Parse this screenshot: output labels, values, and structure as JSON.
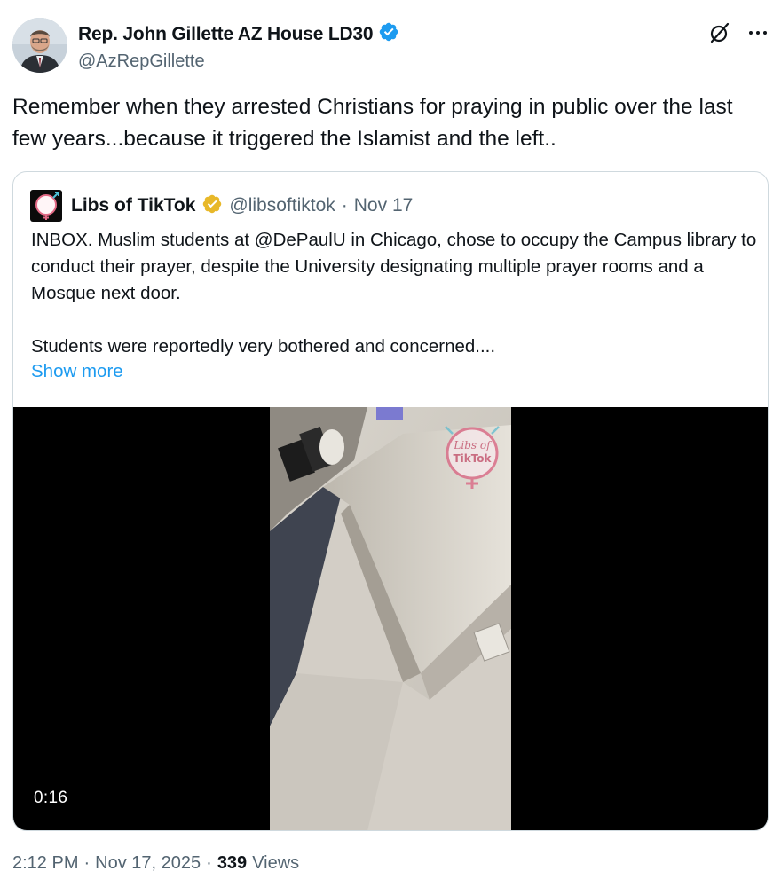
{
  "author": {
    "name": "Rep. John Gillette AZ House LD30",
    "handle": "@AzRepGillette",
    "verified_color": "#1d9bf0"
  },
  "header_icons": [
    "grok-icon",
    "more-icon"
  ],
  "tweet": {
    "text": "Remember when they arrested Christians for praying in public over the last few years...because it triggered the Islamist and the left.."
  },
  "quote": {
    "name": "Libs of TikTok",
    "handle": "@libsoftiktok",
    "separator": "·",
    "date": "Nov 17",
    "verified_color": "#e8b829",
    "avatar_text": "Libs of TikTok",
    "body": "INBOX. Muslim students at @DePaulU in Chicago, chose to occupy the Campus library to conduct their prayer, despite the University designating multiple prayer rooms and a Mosque next door.\n\nStudents were reportedly very bothered and concerned....",
    "show_more": "Show more",
    "video": {
      "duration": "0:16",
      "watermark": "Libs of TikTok"
    }
  },
  "meta": {
    "time": "2:12 PM",
    "separator1": "·",
    "date": "Nov 17, 2025",
    "separator2": "·",
    "views_count": "339",
    "views_label": "Views"
  },
  "colors": {
    "text_primary": "#0f1419",
    "text_secondary": "#536471",
    "link": "#1d9bf0",
    "border": "#cfd9de"
  }
}
